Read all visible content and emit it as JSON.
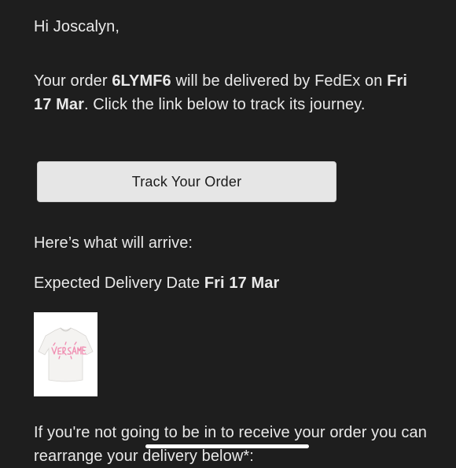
{
  "email": {
    "greeting": "Hi Joscalyn,",
    "order_text_before": "Your order ",
    "order_number": "6LYMF6",
    "order_text_carrier": " will be delivered by FedEx on ",
    "delivery_date": "Fri 17 Mar",
    "order_text_after": ". Click the link below to track its journey.",
    "track_button_label": "Track Your Order",
    "arrive_heading": "Here’s what will arrive:",
    "expected_label": "Expected Delivery Date ",
    "expected_date": "Fri 17 Mar",
    "product_image_alt": "T-shirt",
    "rearrange_text": "If you're not going to be in to receive your order you can rearrange your delivery below*:"
  },
  "colors": {
    "background": "#1e1e1e",
    "text": "#e9e9e9",
    "button_bg": "#e6e6e6",
    "button_text": "#1a1a1a",
    "print_pink": "#f08bb0"
  }
}
